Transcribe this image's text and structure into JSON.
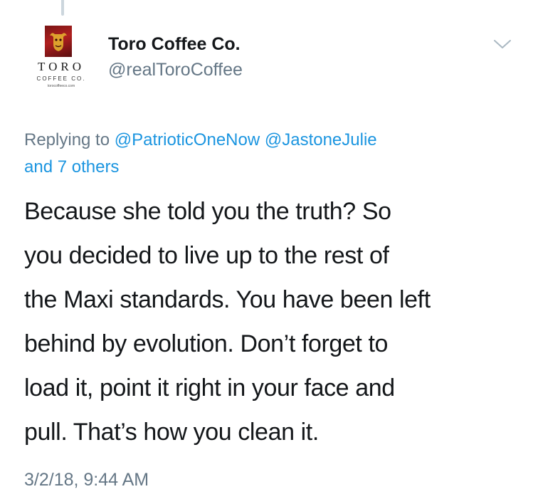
{
  "tweet": {
    "display_name": "Toro Coffee Co.",
    "handle": "@realToroCoffee",
    "avatar": {
      "wordmark": "TORO",
      "subtitle": "COFFEE CO.",
      "url_text": "torocoffeeco.com"
    },
    "reply": {
      "prefix": "Replying to",
      "mentions": [
        "@PatrioticOneNow",
        "@JastoneJulie"
      ],
      "others": "and 7 others"
    },
    "text_lines": [
      "Because she told you the truth? So",
      "you decided to live up to the rest of",
      "the Maxi standards. You have been left",
      "behind by evolution. Don’t forget to",
      "load it, point it right in your face and",
      "pull. That’s how you clean it."
    ],
    "timestamp": "3/2/18, 9:44 AM"
  },
  "icons": {
    "menu": "chevron-down-icon"
  },
  "colors": {
    "text_primary": "#14171a",
    "text_secondary": "#657786",
    "link": "#1b95e0",
    "thread_line": "#ccd6dd"
  }
}
